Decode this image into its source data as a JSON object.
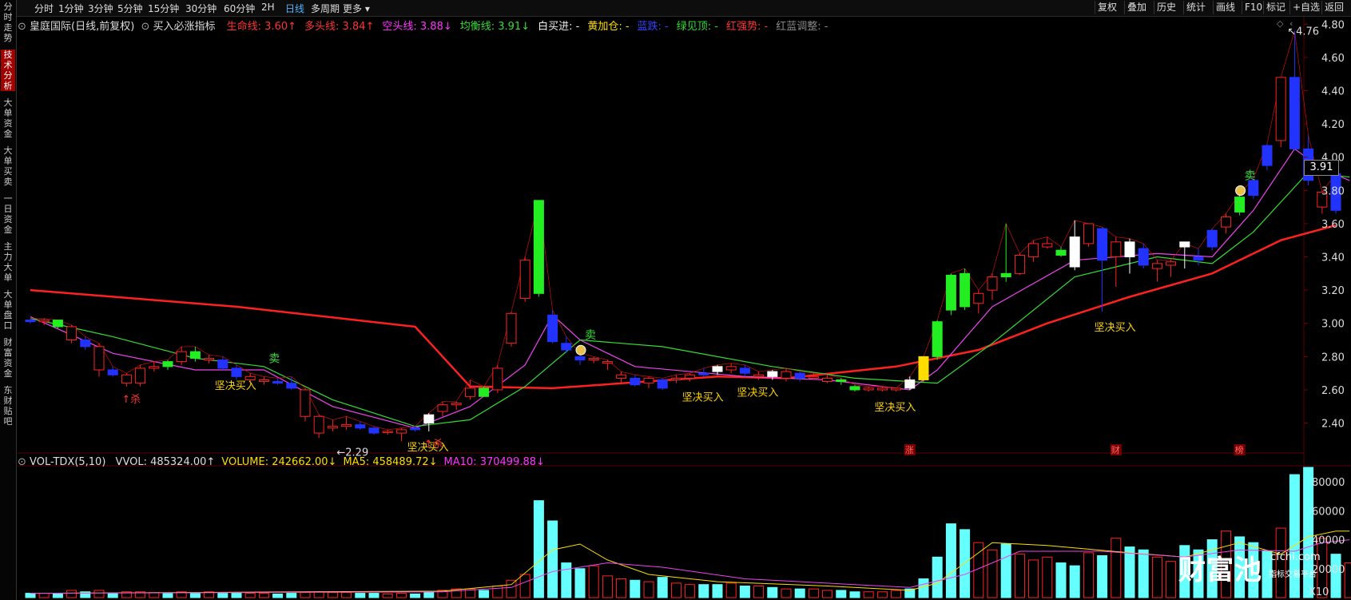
{
  "toolbar": {
    "left": [
      "分时",
      "1分钟",
      "3分钟",
      "5分钟",
      "15分钟",
      "30分钟",
      "60分钟",
      "2H",
      "日线",
      "多周期",
      "更多 ▾"
    ],
    "active_index": 8,
    "right": [
      "复权",
      "叠加",
      "历史",
      "统计",
      "画线",
      "F10",
      "标记",
      "+自选",
      "返回"
    ]
  },
  "sidebar": {
    "items": [
      "分时走势",
      "技术分析",
      "大单资金",
      "大单买卖",
      "一日资金",
      "主力大单",
      "大单盘口",
      "财富资金",
      "东财贴吧"
    ],
    "active_index": 1
  },
  "header": {
    "stock": "皇庭国际(日线,前复权)",
    "indicator": "买入必涨指标",
    "items": [
      {
        "text": "生命线: 3.60↑",
        "color": "#ff3333"
      },
      {
        "text": "多头线: 3.84↑",
        "color": "#ff3333"
      },
      {
        "text": "空头线: 3.88↓",
        "color": "#ff33ff"
      },
      {
        "text": "均衡线: 3.91↓",
        "color": "#33dd33"
      },
      {
        "text": "白买进: -",
        "color": "#eeeeee"
      },
      {
        "text": "黄加仓: -",
        "color": "#ffdd00"
      },
      {
        "text": "蓝跌: -",
        "color": "#3344ff"
      },
      {
        "text": "绿见顶: -",
        "color": "#33dd33"
      },
      {
        "text": "红强势: -",
        "color": "#ff3333"
      },
      {
        "text": "红蓝调整: -",
        "color": "#888888"
      }
    ]
  },
  "vol_header": {
    "name": "VOL-TDX(5,10)",
    "items": [
      {
        "text": "VVOL: 485324.00↑",
        "color": "#dddddd"
      },
      {
        "text": "VOLUME: 242662.00↓",
        "color": "#ffdd00"
      },
      {
        "text": "MA5: 458489.72↓",
        "color": "#ffdd00"
      },
      {
        "text": "MA10: 370499.88↓",
        "color": "#ff33ff"
      }
    ]
  },
  "colors": {
    "up": "#ff2222",
    "down": "#2233ff",
    "white": "#ffffff",
    "yellow": "#ffdd00",
    "green": "#22ee22",
    "cyan": "#66ffff",
    "life": "#ff2020",
    "purple": "#ee44ee",
    "greenline": "#33dd33"
  },
  "chart_data": {
    "type": "candlestick",
    "y_ticks": [
      4.8,
      4.6,
      4.4,
      4.2,
      4.0,
      3.8,
      3.6,
      3.4,
      3.2,
      3.0,
      2.8,
      2.6,
      2.4
    ],
    "ylim": [
      2.22,
      4.84
    ],
    "current_price": "3.91",
    "high_label": "4.76",
    "low_label": "2.29",
    "candles": [
      [
        3.02,
        3.03,
        3.0,
        3.01,
        "d"
      ],
      [
        3.01,
        3.03,
        2.99,
        3.02,
        "u"
      ],
      [
        3.02,
        3.02,
        2.97,
        2.98,
        "g"
      ],
      [
        2.98,
        2.99,
        2.88,
        2.9,
        "u"
      ],
      [
        2.9,
        2.92,
        2.84,
        2.86,
        "d"
      ],
      [
        2.86,
        2.88,
        2.68,
        2.72,
        "u"
      ],
      [
        2.72,
        2.74,
        2.68,
        2.69,
        "d"
      ],
      [
        2.69,
        2.7,
        2.62,
        2.64,
        "u"
      ],
      [
        2.64,
        2.75,
        2.62,
        2.73,
        "u"
      ],
      [
        2.73,
        2.77,
        2.71,
        2.74,
        "u"
      ],
      [
        2.74,
        2.78,
        2.72,
        2.77,
        "g"
      ],
      [
        2.77,
        2.86,
        2.75,
        2.83,
        "u"
      ],
      [
        2.83,
        2.86,
        2.77,
        2.79,
        "g"
      ],
      [
        2.79,
        2.81,
        2.76,
        2.78,
        "u"
      ],
      [
        2.78,
        2.8,
        2.72,
        2.73,
        "d"
      ],
      [
        2.73,
        2.75,
        2.66,
        2.68,
        "d"
      ],
      [
        2.68,
        2.7,
        2.64,
        2.66,
        "u"
      ],
      [
        2.66,
        2.68,
        2.63,
        2.65,
        "u"
      ],
      [
        2.65,
        2.67,
        2.63,
        2.64,
        "d"
      ],
      [
        2.64,
        2.68,
        2.6,
        2.61,
        "d"
      ],
      [
        2.6,
        2.61,
        2.41,
        2.44,
        "u"
      ],
      [
        2.44,
        2.45,
        2.31,
        2.34,
        "u"
      ],
      [
        2.37,
        2.42,
        2.35,
        2.38,
        "u"
      ],
      [
        2.38,
        2.44,
        2.36,
        2.39,
        "u"
      ],
      [
        2.39,
        2.41,
        2.36,
        2.37,
        "d"
      ],
      [
        2.37,
        2.38,
        2.33,
        2.34,
        "d"
      ],
      [
        2.35,
        2.36,
        2.33,
        2.35,
        "u"
      ],
      [
        2.34,
        2.37,
        2.29,
        2.36,
        "u"
      ],
      [
        2.36,
        2.38,
        2.35,
        2.37,
        "d"
      ],
      [
        2.4,
        2.46,
        2.35,
        2.45,
        "w"
      ],
      [
        2.47,
        2.53,
        2.44,
        2.51,
        "u"
      ],
      [
        2.51,
        2.53,
        2.48,
        2.52,
        "u"
      ],
      [
        2.56,
        2.66,
        2.54,
        2.61,
        "u"
      ],
      [
        2.56,
        2.62,
        2.56,
        2.61,
        "g"
      ],
      [
        2.6,
        2.75,
        2.58,
        2.73,
        "u"
      ],
      [
        2.88,
        3.07,
        2.86,
        3.06,
        "u"
      ],
      [
        3.15,
        3.4,
        3.13,
        3.38,
        "u"
      ],
      [
        3.18,
        3.74,
        3.16,
        3.74,
        "g"
      ],
      [
        3.05,
        3.08,
        2.88,
        2.89,
        "d"
      ],
      [
        2.88,
        2.92,
        2.82,
        2.84,
        "d"
      ],
      [
        2.8,
        2.82,
        2.75,
        2.78,
        "d"
      ],
      [
        2.78,
        2.8,
        2.76,
        2.79,
        "u"
      ],
      [
        2.76,
        2.78,
        2.72,
        2.77,
        "u"
      ],
      [
        2.69,
        2.71,
        2.64,
        2.67,
        "u"
      ],
      [
        2.67,
        2.69,
        2.62,
        2.63,
        "d"
      ],
      [
        2.64,
        2.68,
        2.61,
        2.67,
        "u"
      ],
      [
        2.61,
        2.67,
        2.6,
        2.66,
        "d"
      ],
      [
        2.66,
        2.69,
        2.64,
        2.67,
        "u"
      ],
      [
        2.67,
        2.7,
        2.65,
        2.69,
        "u"
      ],
      [
        2.69,
        2.73,
        2.68,
        2.7,
        "d"
      ],
      [
        2.71,
        2.75,
        2.69,
        2.74,
        "w"
      ],
      [
        2.74,
        2.76,
        2.7,
        2.72,
        "u"
      ],
      [
        2.73,
        2.75,
        2.68,
        2.7,
        "d"
      ],
      [
        2.69,
        2.71,
        2.66,
        2.68,
        "u"
      ],
      [
        2.68,
        2.72,
        2.66,
        2.71,
        "w"
      ],
      [
        2.71,
        2.73,
        2.65,
        2.67,
        "u"
      ],
      [
        2.67,
        2.71,
        2.65,
        2.7,
        "d"
      ],
      [
        2.68,
        2.7,
        2.66,
        2.67,
        "u"
      ],
      [
        2.67,
        2.69,
        2.64,
        2.65,
        "u"
      ],
      [
        2.65,
        2.67,
        2.63,
        2.66,
        "g"
      ],
      [
        2.62,
        2.63,
        2.59,
        2.6,
        "g"
      ],
      [
        2.6,
        2.62,
        2.59,
        2.61,
        "u"
      ],
      [
        2.61,
        2.62,
        2.59,
        2.6,
        "u"
      ],
      [
        2.6,
        2.61,
        2.59,
        2.61,
        "u"
      ],
      [
        2.61,
        2.68,
        2.6,
        2.66,
        "w"
      ],
      [
        2.66,
        2.8,
        2.65,
        2.8,
        "y"
      ],
      [
        2.8,
        3.02,
        2.78,
        3.01,
        "g"
      ],
      [
        3.08,
        3.3,
        3.05,
        3.29,
        "g"
      ],
      [
        3.1,
        3.33,
        3.08,
        3.3,
        "g"
      ],
      [
        3.12,
        3.2,
        3.06,
        3.18,
        "u"
      ],
      [
        3.2,
        3.3,
        3.14,
        3.28,
        "u"
      ],
      [
        3.28,
        3.6,
        3.25,
        3.3,
        "g"
      ],
      [
        3.3,
        3.42,
        3.29,
        3.41,
        "u"
      ],
      [
        3.4,
        3.5,
        3.37,
        3.48,
        "u"
      ],
      [
        3.48,
        3.52,
        3.45,
        3.46,
        "u"
      ],
      [
        3.44,
        3.46,
        3.4,
        3.41,
        "g"
      ],
      [
        3.34,
        3.62,
        3.32,
        3.52,
        "w"
      ],
      [
        3.48,
        3.6,
        3.46,
        3.6,
        "u"
      ],
      [
        3.57,
        3.58,
        3.07,
        3.38,
        "d"
      ],
      [
        3.49,
        3.52,
        3.22,
        3.4,
        "u"
      ],
      [
        3.4,
        3.51,
        3.3,
        3.49,
        "w"
      ],
      [
        3.45,
        3.48,
        3.33,
        3.35,
        "d"
      ],
      [
        3.36,
        3.38,
        3.25,
        3.33,
        "u"
      ],
      [
        3.35,
        3.38,
        3.28,
        3.37,
        "u"
      ],
      [
        3.46,
        3.48,
        3.33,
        3.49,
        "w"
      ],
      [
        3.38,
        3.45,
        3.35,
        3.4,
        "d"
      ],
      [
        3.46,
        3.57,
        3.44,
        3.56,
        "d"
      ],
      [
        3.58,
        3.66,
        3.54,
        3.64,
        "u"
      ],
      [
        3.67,
        3.78,
        3.65,
        3.76,
        "g"
      ],
      [
        3.77,
        3.87,
        3.75,
        3.86,
        "d"
      ],
      [
        3.95,
        4.08,
        3.92,
        4.07,
        "d"
      ],
      [
        4.1,
        4.48,
        4.06,
        4.48,
        "u"
      ],
      [
        4.05,
        4.76,
        4.04,
        4.48,
        "d"
      ],
      [
        4.05,
        4.13,
        3.83,
        3.86,
        "d"
      ],
      [
        3.7,
        3.79,
        3.66,
        3.79,
        "u"
      ],
      [
        3.68,
        3.9,
        3.66,
        3.9,
        "d"
      ]
    ],
    "lines": {
      "life": [
        [
          0,
          3.2
        ],
        [
          15,
          3.1
        ],
        [
          28,
          2.98
        ],
        [
          32,
          2.62
        ],
        [
          38,
          2.61
        ],
        [
          50,
          2.68
        ],
        [
          55,
          2.67
        ],
        [
          63,
          2.74
        ],
        [
          69,
          2.84
        ],
        [
          74,
          3.0
        ],
        [
          80,
          3.16
        ],
        [
          86,
          3.3
        ],
        [
          91,
          3.5
        ],
        [
          95,
          3.59
        ]
      ],
      "purple": [
        [
          0,
          3.04
        ],
        [
          6,
          2.82
        ],
        [
          12,
          2.72
        ],
        [
          17,
          2.72
        ],
        [
          22,
          2.5
        ],
        [
          28,
          2.37
        ],
        [
          32,
          2.5
        ],
        [
          36,
          2.75
        ],
        [
          38,
          3.05
        ],
        [
          40,
          2.9
        ],
        [
          44,
          2.74
        ],
        [
          52,
          2.68
        ],
        [
          58,
          2.66
        ],
        [
          64,
          2.6
        ],
        [
          66,
          2.72
        ],
        [
          70,
          3.1
        ],
        [
          76,
          3.38
        ],
        [
          82,
          3.42
        ],
        [
          86,
          3.4
        ],
        [
          89,
          3.68
        ],
        [
          92,
          4.05
        ],
        [
          94,
          3.93
        ],
        [
          96,
          3.86
        ]
      ],
      "green": [
        [
          0,
          3.03
        ],
        [
          6,
          2.92
        ],
        [
          12,
          2.79
        ],
        [
          17,
          2.74
        ],
        [
          22,
          2.54
        ],
        [
          28,
          2.38
        ],
        [
          32,
          2.42
        ],
        [
          36,
          2.62
        ],
        [
          40,
          2.9
        ],
        [
          46,
          2.86
        ],
        [
          54,
          2.74
        ],
        [
          60,
          2.67
        ],
        [
          66,
          2.64
        ],
        [
          70,
          2.88
        ],
        [
          76,
          3.28
        ],
        [
          82,
          3.4
        ],
        [
          86,
          3.36
        ],
        [
          89,
          3.55
        ],
        [
          93,
          3.91
        ],
        [
          96,
          3.88
        ]
      ]
    },
    "volume": {
      "y_ticks": [
        "80000",
        "60000",
        "40000",
        "20000"
      ],
      "multiplier_label": "X10",
      "vmax": 90000,
      "bars": [
        3000,
        3000,
        2500,
        5000,
        4000,
        5000,
        3000,
        4000,
        4000,
        3500,
        3000,
        4000,
        3000,
        4000,
        3000,
        3500,
        3000,
        3000,
        2500,
        3000,
        3500,
        4000,
        3500,
        3500,
        3000,
        3000,
        2500,
        3000,
        2500,
        4000,
        5000,
        6000,
        6000,
        5000,
        8000,
        12000,
        16000,
        67000,
        53000,
        24000,
        20000,
        22000,
        15000,
        13000,
        12000,
        11000,
        14000,
        10000,
        9000,
        9000,
        9000,
        10000,
        8000,
        8000,
        7000,
        6000,
        6000,
        6000,
        5000,
        5000,
        4000,
        4000,
        4000,
        5000,
        6000,
        13000,
        28000,
        51000,
        47000,
        38000,
        33000,
        37000,
        30000,
        26000,
        28000,
        24000,
        22000,
        31000,
        29000,
        41000,
        35000,
        33000,
        28000,
        25000,
        36000,
        33000,
        40000,
        46000,
        42000,
        38000,
        32000,
        48000,
        85000,
        90000,
        41000,
        30000,
        24000
      ],
      "ma5": [
        [
          0,
          3000
        ],
        [
          30,
          4500
        ],
        [
          35,
          9000
        ],
        [
          38,
          33000
        ],
        [
          40,
          37000
        ],
        [
          42,
          26000
        ],
        [
          45,
          16000
        ],
        [
          50,
          11000
        ],
        [
          58,
          8000
        ],
        [
          64,
          5000
        ],
        [
          66,
          10000
        ],
        [
          70,
          38000
        ],
        [
          74,
          36000
        ],
        [
          80,
          31000
        ],
        [
          84,
          28000
        ],
        [
          88,
          38000
        ],
        [
          91,
          30000
        ],
        [
          93,
          42000
        ],
        [
          95,
          46000
        ],
        [
          96,
          46000
        ]
      ],
      "ma10": [
        [
          0,
          3000
        ],
        [
          30,
          4000
        ],
        [
          35,
          7000
        ],
        [
          38,
          18000
        ],
        [
          42,
          24000
        ],
        [
          46,
          21000
        ],
        [
          52,
          13000
        ],
        [
          60,
          9000
        ],
        [
          64,
          7000
        ],
        [
          68,
          16000
        ],
        [
          72,
          32000
        ],
        [
          78,
          32000
        ],
        [
          84,
          28000
        ],
        [
          88,
          33000
        ],
        [
          92,
          32000
        ],
        [
          94,
          38000
        ],
        [
          96,
          40000
        ]
      ]
    },
    "markers": {
      "hazard_sell": [
        7,
        29
      ],
      "buy_labels": [
        14,
        28,
        48,
        52,
        62,
        78
      ],
      "sell_labels": [
        17,
        40,
        88
      ],
      "bag_icons": [
        40,
        88
      ]
    },
    "bottom_labels": [
      {
        "i": 64,
        "text": "涨"
      },
      {
        "i": 79,
        "text": "财"
      },
      {
        "i": 88,
        "text": "榜"
      }
    ]
  },
  "labels": {
    "buy": "坚决买入",
    "sell": "卖",
    "kill": "杀"
  },
  "watermark": {
    "brand": "财富池",
    "domain": "cfchi.com",
    "slogan": "指标交易平台"
  }
}
